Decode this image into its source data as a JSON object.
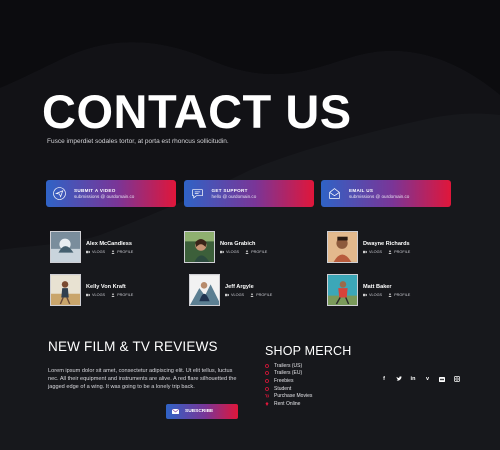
{
  "hero": {
    "title": "CONTACT US",
    "subtitle": "Fusce imperdiet sodales tortor, at porta est rhoncus sollicitudin."
  },
  "contact_cards": [
    {
      "title": "SUBMIT A VIDEO",
      "email": "submissions @ ourdomain.co",
      "icon": "paper-plane-icon"
    },
    {
      "title": "GET SUPPORT",
      "email": "hello @ ourdomain.co",
      "icon": "chat-bubble-icon"
    },
    {
      "title": "EMAIL US",
      "email": "submissions @ ourdomain.co",
      "icon": "envelope-icon"
    }
  ],
  "people": [
    {
      "name": "Alex McCandless",
      "vlogs": "VLOGS",
      "profile": "PROFILE"
    },
    {
      "name": "Nora Grabich",
      "vlogs": "VLOGS",
      "profile": "PROFILE"
    },
    {
      "name": "Dwayne Richards",
      "vlogs": "VLOGS",
      "profile": "PROFILE"
    },
    {
      "name": "Kelly Von Kraft",
      "vlogs": "VLOGS",
      "profile": "PROFILE"
    },
    {
      "name": "Jeff Argyle",
      "vlogs": "VLOGS",
      "profile": "PROFILE"
    },
    {
      "name": "Matt Baker",
      "vlogs": "VLOGS",
      "profile": "PROFILE"
    }
  ],
  "reviews": {
    "heading": "NEW FILM & TV REVIEWS",
    "text": "Lorem ipsum dolor sit amet, consectetur adipiscing elit. Ut elit tellus, luctus nec. All their equipment and instruments are alive. A red flare silhouetted the jagged edge of a wing. It was going to be a lonely trip back.",
    "button": "SUBSCRIBE"
  },
  "merch": {
    "heading": "SHOP MERCH",
    "items": [
      "Trailers (US)",
      "Trailers (EU)",
      "Freebies",
      "Student",
      "Purchase Movies",
      "Rent Online"
    ]
  },
  "social_icons": [
    "facebook-icon",
    "twitter-icon",
    "linkedin-icon",
    "vimeo-icon",
    "flickr-icon",
    "instagram-icon"
  ],
  "colors": {
    "background": "#17181c",
    "gradient_start": "#2f63c6",
    "gradient_end": "#e0163a",
    "accent_red": "#e0163a"
  }
}
